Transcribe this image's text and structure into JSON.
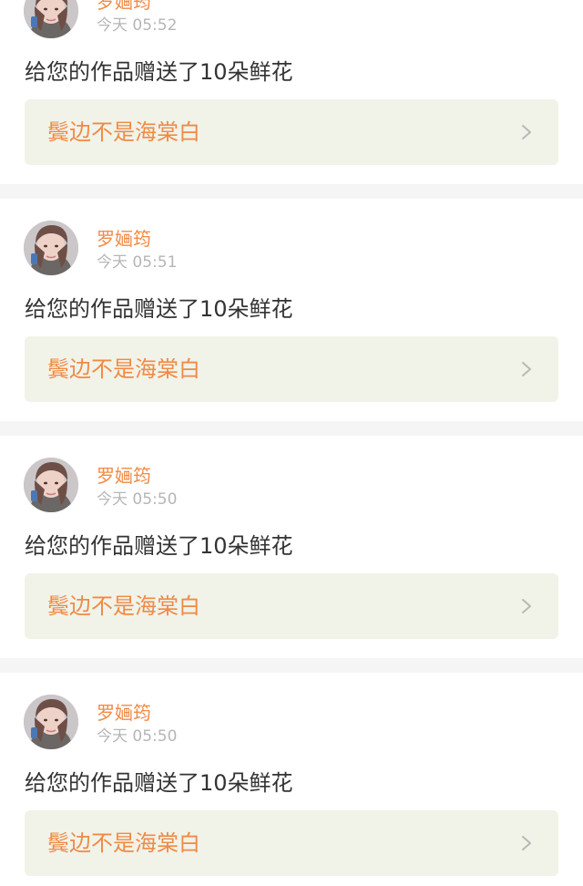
{
  "feed": {
    "items": [
      {
        "username": "罗婳筠",
        "timestamp": "今天 05:52",
        "message": "给您的作品赠送了10朵鲜花",
        "work_title": "鬓边不是海棠白"
      },
      {
        "username": "罗婳筠",
        "timestamp": "今天 05:51",
        "message": "给您的作品赠送了10朵鲜花",
        "work_title": "鬓边不是海棠白"
      },
      {
        "username": "罗婳筠",
        "timestamp": "今天 05:50",
        "message": "给您的作品赠送了10朵鲜花",
        "work_title": "鬓边不是海棠白"
      },
      {
        "username": "罗婳筠",
        "timestamp": "今天 05:50",
        "message": "给您的作品赠送了10朵鲜花",
        "work_title": "鬓边不是海棠白"
      }
    ]
  },
  "colors": {
    "page_background": "#ffffff",
    "separator": "#f5f5f5",
    "accent": "#f08a46",
    "link_card_background": "#f1f3e8",
    "timestamp": "#b6b6b6",
    "text_primary": "#333333"
  },
  "icons": {
    "avatar": "avatar-photo",
    "chevron": "chevron-right-icon"
  }
}
